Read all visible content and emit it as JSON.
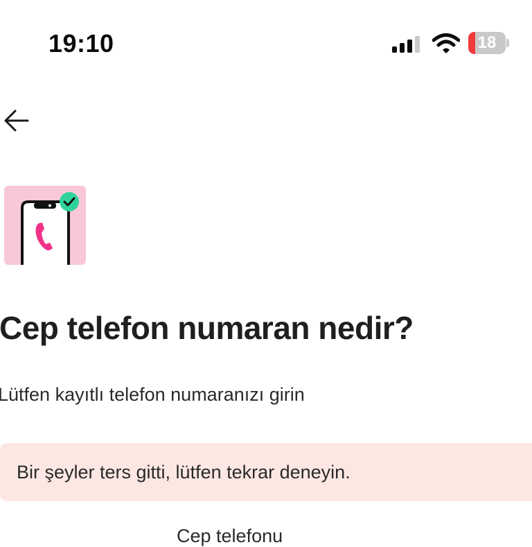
{
  "status_bar": {
    "time": "19:10",
    "signal_icon": "cellular-signal-icon",
    "wifi_icon": "wifi-icon",
    "battery_level": "18",
    "battery_fraction": 0.18,
    "battery_color": "#ef3b3b"
  },
  "nav": {
    "back_icon": "arrow-left-icon"
  },
  "illustration": {
    "icon": "phone-verified-illustration",
    "background_color": "#f8c8d6",
    "accent_color": "#f0318a",
    "check_color": "#2fd39a"
  },
  "header": {
    "title": "Cep telefon numaran nedir?",
    "subtitle": "Lütfen kayıtlı telefon numaranızı girin"
  },
  "error": {
    "message": "Bir şeyler ters gitti, lütfen tekrar deneyin.",
    "background_color": "#fde7e3"
  },
  "form": {
    "phone_label": "Cep telefonu"
  }
}
